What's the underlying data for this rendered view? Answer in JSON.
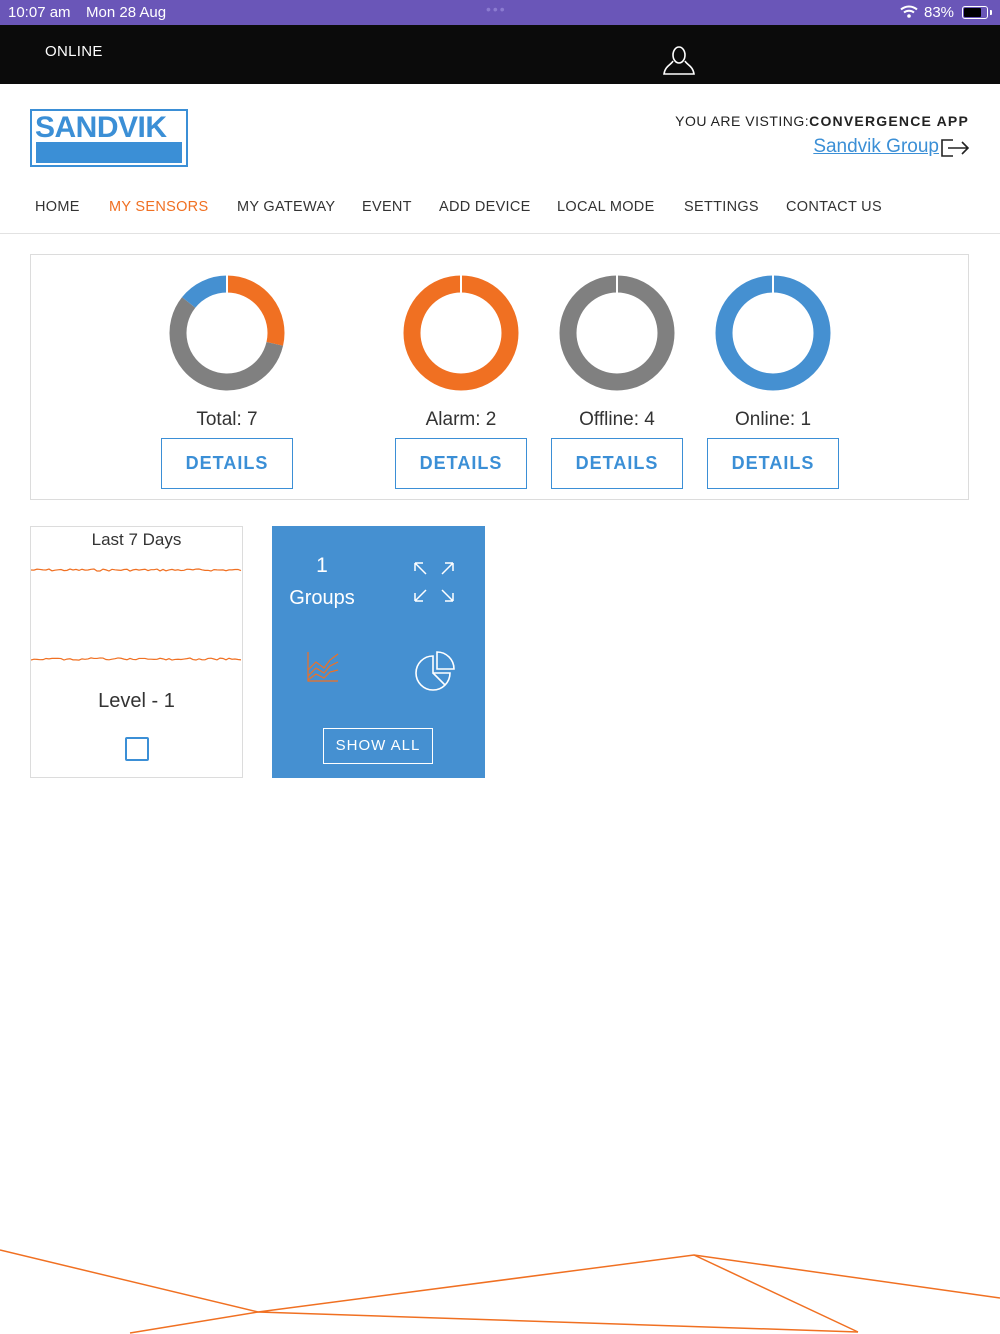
{
  "statusbar": {
    "time": "10:07 am",
    "date": "Mon 28 Aug",
    "battery": "83%",
    "battery_level": 0.83
  },
  "topbar": {
    "connection_status": "ONLINE"
  },
  "header": {
    "logo_text": "SANDVIK",
    "visiting_prefix": "YOU ARE VISTING:",
    "visiting_app": "CONVERGENCE APP",
    "group_link": "Sandvik Group"
  },
  "nav": {
    "items": [
      "HOME",
      "MY SENSORS",
      "MY GATEWAY",
      "EVENT",
      "ADD DEVICE",
      "LOCAL MODE",
      "SETTINGS",
      "CONTACT US"
    ],
    "active": "MY SENSORS"
  },
  "summary": {
    "details_label": "DETAILS",
    "stats": [
      {
        "label": "Total: 7"
      },
      {
        "label": "Alarm: 2"
      },
      {
        "label": "Offline: 4"
      },
      {
        "label": "Online: 1"
      }
    ]
  },
  "chart_data": [
    {
      "type": "pie",
      "labels": [
        "Alarm",
        "Offline",
        "Online"
      ],
      "values": [
        2,
        4,
        1
      ],
      "colors": [
        "#f07022",
        "#808080",
        "#4590d1"
      ]
    },
    {
      "type": "pie",
      "labels": [
        "Alarm"
      ],
      "values": [
        2
      ],
      "colors": [
        "#f07022"
      ]
    },
    {
      "type": "pie",
      "labels": [
        "Offline"
      ],
      "values": [
        4
      ],
      "colors": [
        "#808080"
      ]
    },
    {
      "type": "pie",
      "labels": [
        "Online"
      ],
      "values": [
        1
      ],
      "colors": [
        "#4590d1"
      ]
    }
  ],
  "trend_card": {
    "title": "Last 7 Days",
    "level_label": "Level - 1",
    "line_color": "#f07022"
  },
  "groups_card": {
    "count": "1",
    "label": "Groups",
    "show_all": "SHOW ALL"
  },
  "colors": {
    "accent_blue": "#3b8fd6",
    "accent_orange": "#f07022",
    "offline_gray": "#808080"
  }
}
